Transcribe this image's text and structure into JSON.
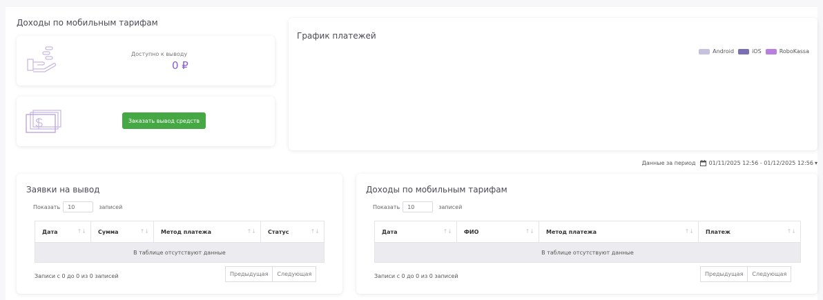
{
  "income_section": {
    "title": "Доходы по мобильным тарифам"
  },
  "balance": {
    "label": "Доступно к выводу",
    "amount": "0 ₽"
  },
  "withdraw": {
    "button_label": "Заказать вывод средств"
  },
  "chart": {
    "title": "График платежей",
    "legend": [
      {
        "name": "Android",
        "color": "#c5c1de"
      },
      {
        "name": "iOS",
        "color": "#7a6fb3"
      },
      {
        "name": "RoboKassa",
        "color": "#b87ee0"
      }
    ]
  },
  "period": {
    "label": "Данные за период",
    "range": "01/11/2025 12:56 - 01/12/2025 12:56"
  },
  "withdraw_table": {
    "title": "Заявки на вывод",
    "show_label": "Показать",
    "show_value": "10",
    "records_label": "записей",
    "columns": [
      "Дата",
      "Сумма",
      "Метод платежа",
      "Статус"
    ],
    "empty_text": "В таблице отсутствуют данные",
    "info": "Записи с 0 до 0 из 0 записей",
    "prev": "Предыдущая",
    "next": "Следующая"
  },
  "income_table": {
    "title": "Доходы по мобильным тарифам",
    "show_label": "Показать",
    "show_value": "10",
    "records_label": "записей",
    "columns": [
      "Дата",
      "ФИО",
      "Метод платежа",
      "Платеж"
    ],
    "empty_text": "В таблице отсутствуют данные",
    "info": "Записи с 0 до 0 из 0 записей",
    "prev": "Предыдущая",
    "next": "Следующая"
  }
}
